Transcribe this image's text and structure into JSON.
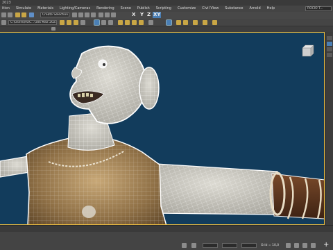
{
  "window": {
    "title": "2023"
  },
  "menu": {
    "items": [
      "ition",
      "Simulate",
      "Materials",
      "Lighting/Cameras",
      "Rendering",
      "Scene",
      "Publish",
      "Scripting",
      "Customize",
      "Civil View",
      "Substance",
      "Arnold",
      "Help"
    ],
    "search_label": "ROCIO T..."
  },
  "toolbar": {
    "selection_set": "Create Selection Se",
    "axis_x": "X",
    "axis_y": "Y",
    "axis_z": "Z",
    "axis_xy": "XY",
    "file_label": "C:\\Users\\ROC...\\3ds Max 2023"
  },
  "tabs": {
    "object_paint": "Object Paint",
    "populate": "Populate"
  },
  "status": {
    "grid_label": "Grid = 10,0"
  },
  "colors": {
    "viewport_bg": "#123c5c",
    "selection_border": "#f0c040",
    "mesh_wire": "#ffffff"
  }
}
